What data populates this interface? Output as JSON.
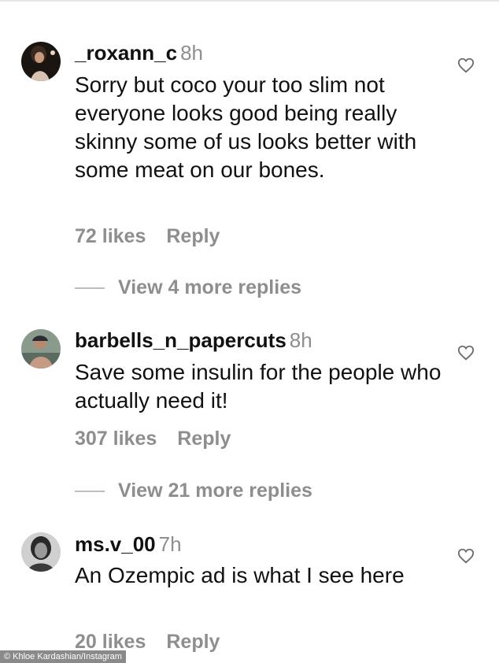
{
  "comments": [
    {
      "username": "_roxann_c",
      "time": "8h",
      "text": "Sorry but coco your too slim not everyone looks good being really skinny some of us looks better with some meat on our bones.",
      "likes": "72 likes",
      "reply_label": "Reply",
      "view_replies": "View 4 more replies"
    },
    {
      "username": "barbells_n_papercuts",
      "time": "8h",
      "text": "Save some insulin for the people who actually need it!",
      "likes": "307 likes",
      "reply_label": "Reply",
      "view_replies": "View 21 more replies"
    },
    {
      "username": "ms.v_00",
      "time": "7h",
      "text": "An Ozempic ad is what I see here",
      "likes": "20 likes",
      "reply_label": "Reply"
    }
  ],
  "credit": "© Khloe Kardashian/Instagram",
  "icons": {
    "like": "heart-outline-icon"
  },
  "colors": {
    "text": "#111111",
    "muted": "#8e8e8e",
    "background": "#ffffff"
  }
}
